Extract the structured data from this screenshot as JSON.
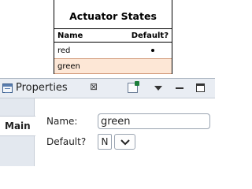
{
  "diagram": {
    "title": "Actuator States",
    "columns": [
      "Name",
      "Default?"
    ],
    "rows": [
      {
        "name": "red",
        "default": true,
        "selected": false
      },
      {
        "name": "green",
        "default": false,
        "selected": true
      }
    ]
  },
  "properties": {
    "view_title": "Properties",
    "close_glyph": "⊠",
    "side_tab": "Main",
    "name_label": "Name:",
    "name_value": "green",
    "default_label": "Default?",
    "default_value": "N"
  },
  "icons": {
    "view": "properties-view-icon",
    "pin": "pin-icon",
    "menu": "view-menu-icon",
    "minimize": "minimize-icon",
    "maximize": "maximize-icon",
    "dropdown": "chevron-down-icon"
  },
  "colors": {
    "selection_fill": "#fde7d6",
    "selection_border": "#d39c7c",
    "panel_background": "#eef2f7"
  }
}
